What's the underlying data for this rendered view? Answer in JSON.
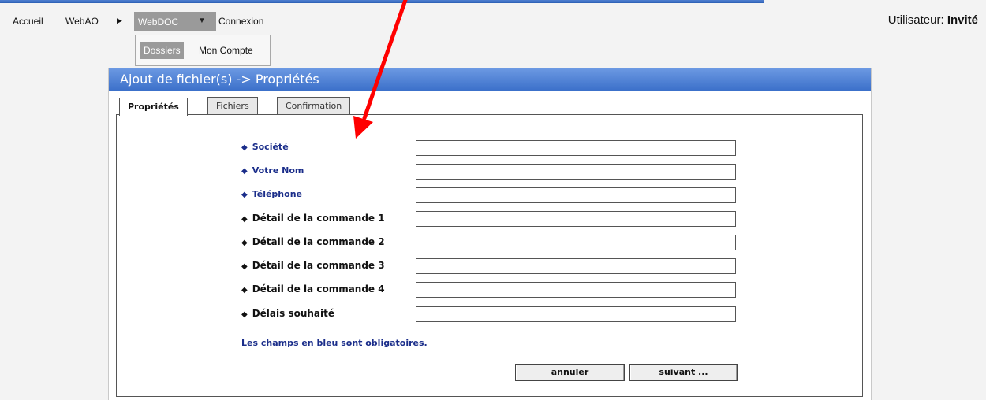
{
  "nav": {
    "accueil": "Accueil",
    "webao": "WebAO",
    "webdoc": "WebDOC",
    "connexion": "Connexion",
    "user_label": "Utilisateur:",
    "user_name": "Invité"
  },
  "submenu": {
    "dossiers": "Dossiers",
    "compte": "Mon Compte"
  },
  "panel": {
    "title": "Ajout de fichier(s) -> Propriétés",
    "tabs": [
      "Propriétés",
      "Fichiers",
      "Confirmation"
    ]
  },
  "form": {
    "fields": [
      {
        "label": "Société",
        "required": true,
        "value": ""
      },
      {
        "label": "Votre Nom",
        "required": true,
        "value": ""
      },
      {
        "label": "Téléphone",
        "required": true,
        "value": ""
      },
      {
        "label": "Détail de la commande 1",
        "required": false,
        "value": ""
      },
      {
        "label": "Détail de la commande 2",
        "required": false,
        "value": ""
      },
      {
        "label": "Détail de la commande 3",
        "required": false,
        "value": ""
      },
      {
        "label": "Détail de la commande 4",
        "required": false,
        "value": ""
      },
      {
        "label": "Délais souhaité",
        "required": false,
        "value": ""
      }
    ],
    "note": "Les champs en bleu sont obligatoires.",
    "cancel": "annuler",
    "next": "suivant ..."
  },
  "colors": {
    "required_label": "#1a2d8a",
    "header_blue": "#3a6fc9",
    "annotation_arrow": "#ff0000"
  }
}
